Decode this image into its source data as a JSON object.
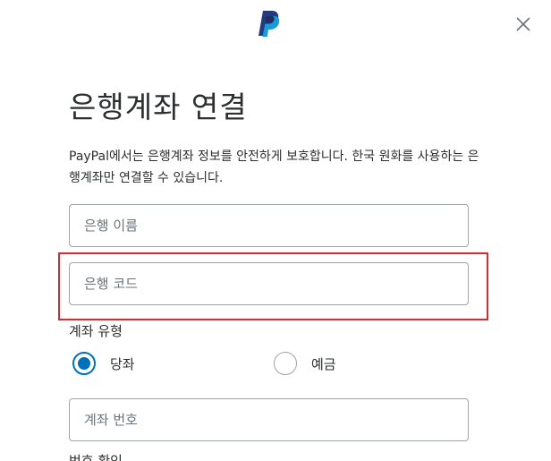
{
  "header": {
    "logo_icon": "paypal-logo-icon",
    "close_icon": "close-icon"
  },
  "title": "은행계좌 연결",
  "description": "PayPal에서는 은행계좌 정보를 안전하게 보호합니다. 한국 원화를 사용하는 은행계좌만 연결할 수 있습니다.",
  "form": {
    "bank_name": {
      "placeholder": "은행 이름",
      "value": ""
    },
    "bank_code": {
      "placeholder": "은행 코드",
      "value": ""
    },
    "account_type": {
      "label": "계좌 유형",
      "options": [
        {
          "label": "당좌",
          "checked": true
        },
        {
          "label": "예금",
          "checked": false
        }
      ]
    },
    "account_number": {
      "placeholder": "계좌 번호",
      "value": ""
    },
    "next_label_cutoff": "번호 확인"
  },
  "colors": {
    "accent": "#0070ba",
    "highlight": "#e0262b",
    "logo_dark": "#253b80",
    "logo_light": "#179bd7"
  }
}
